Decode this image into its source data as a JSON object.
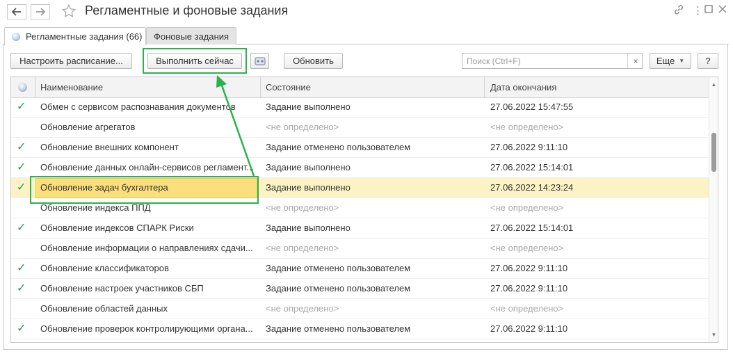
{
  "window": {
    "title": "Регламентные и фоновые задания",
    "back_icon": "arrow-left-icon",
    "forward_icon": "arrow-right-icon",
    "favorite_icon": "star-icon",
    "link_icon": "link-icon",
    "menu_icon": "more-vertical-icon",
    "maximize_icon": "maximize-icon",
    "close_icon": "close-icon"
  },
  "tabs": [
    {
      "label": "Регламентные задания (66)",
      "active": true
    },
    {
      "label": "Фоновые задания",
      "active": false
    }
  ],
  "toolbar": {
    "schedule_label": "Настроить расписание...",
    "run_now_label": "Выполнить сейчас",
    "refresh_label": "Обновить",
    "search_placeholder": "Поиск (Ctrl+F)",
    "clear_label": "×",
    "more_label": "Еще",
    "help_label": "?"
  },
  "table": {
    "columns": {
      "name": "Наименование",
      "state": "Состояние",
      "end_date": "Дата окончания"
    },
    "rows": [
      {
        "check": "✓",
        "name": "Обмен с сервисом распознавания документов",
        "state": "Задание выполнено",
        "date": "27.06.2022 15:47:55",
        "undefined": false,
        "selected": false
      },
      {
        "check": "",
        "name": "Обновление агрегатов",
        "state": "<не определено>",
        "date": "<не определено>",
        "undefined": true,
        "selected": false
      },
      {
        "check": "✓",
        "name": "Обновление внешних компонент",
        "state": "Задание отменено пользователем",
        "date": "27.06.2022 9:11:10",
        "undefined": false,
        "selected": false
      },
      {
        "check": "✓",
        "name": "Обновление данных онлайн-сервисов регламент...",
        "state": "Задание выполнено",
        "date": "27.06.2022 15:14:01",
        "undefined": false,
        "selected": false
      },
      {
        "check": "✓",
        "name": "Обновление задач бухгалтера",
        "state": "Задание выполнено",
        "date": "27.06.2022 14:23:24",
        "undefined": false,
        "selected": true
      },
      {
        "check": "",
        "name": "Обновление индекса ППД",
        "state": "<не определено>",
        "date": "<не определено>",
        "undefined": true,
        "selected": false
      },
      {
        "check": "✓",
        "name": "Обновление индексов СПАРК Риски",
        "state": "Задание выполнено",
        "date": "27.06.2022 15:14:01",
        "undefined": false,
        "selected": false
      },
      {
        "check": "",
        "name": "Обновление информации о направлениях сдачи...",
        "state": "<не определено>",
        "date": "<не определено>",
        "undefined": true,
        "selected": false
      },
      {
        "check": "✓",
        "name": "Обновление классификаторов",
        "state": "Задание отменено пользователем",
        "date": "27.06.2022 9:11:10",
        "undefined": false,
        "selected": false
      },
      {
        "check": "✓",
        "name": "Обновление настроек участников СБП",
        "state": "Задание отменено пользователем",
        "date": "27.06.2022 9:11:10",
        "undefined": false,
        "selected": false
      },
      {
        "check": "",
        "name": "Обновление областей данных",
        "state": "<не определено>",
        "date": "<не определено>",
        "undefined": true,
        "selected": false
      },
      {
        "check": "✓",
        "name": "Обновление проверок контролирующими органа...",
        "state": "Задание отменено пользователем",
        "date": "27.06.2022 9:11:10",
        "undefined": false,
        "selected": false
      }
    ]
  },
  "colors": {
    "annotation": "#2ab24c",
    "selected_row": "#fbf2c6",
    "selected_cell": "#fbdf7c",
    "check": "#1f9e55"
  }
}
